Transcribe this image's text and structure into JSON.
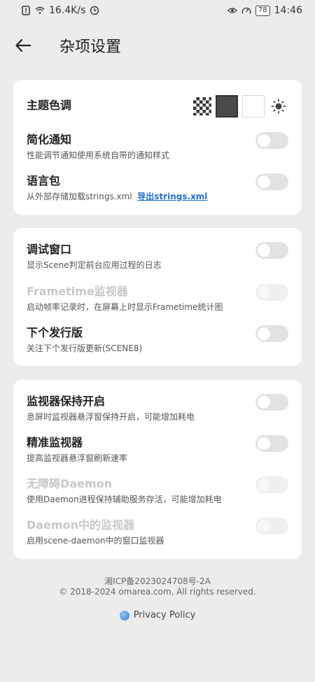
{
  "status_bar": {
    "speed": "16.4K/s",
    "battery": "78",
    "time": "14:46"
  },
  "header": {
    "title": "杂项设置"
  },
  "card1": {
    "theme": {
      "title": "主题色调"
    },
    "notify": {
      "title": "简化通知",
      "sub": "性能调节通知使用系统自带的通知样式"
    },
    "lang": {
      "title": "语言包",
      "sub": "从外部存储加载strings.xml",
      "link": "导出strings.xml"
    }
  },
  "card2": {
    "debug": {
      "title": "调试窗口",
      "sub": "显示Scene判定前台应用过程的日志"
    },
    "frametime": {
      "title": "Frametime监视器",
      "sub": "启动帧率记录时，在屏幕上时显示Frametime统计图"
    },
    "next": {
      "title": "下个发行版",
      "sub": "关注下个发行版更新(SCENE8)"
    }
  },
  "card3": {
    "keep": {
      "title": "监视器保持开启",
      "sub": "息屏时监视器悬浮窗保持开启，可能增加耗电"
    },
    "precise": {
      "title": "精准监视器",
      "sub": "提高监视器悬浮窗刷新速率"
    },
    "barrier": {
      "title": "无障碍Daemon",
      "sub": "使用Daemon进程保持辅助服务存活，可能增加耗电"
    },
    "daemon_monitor": {
      "title": "Daemon中的监视器",
      "sub": "启用scene-daemon中的窗口监视器"
    }
  },
  "footer": {
    "icp": "湘ICP备2023024708号-2A",
    "copyright": "© 2018-2024 omarea.com, All rights reserved.",
    "privacy": "Privacy Policy"
  },
  "colors": {
    "background": "#ececec",
    "card": "#ffffff",
    "toggle_off": "#e2e2e2",
    "link": "#1f6fc9",
    "disabled_text": "#c8c8c8"
  }
}
